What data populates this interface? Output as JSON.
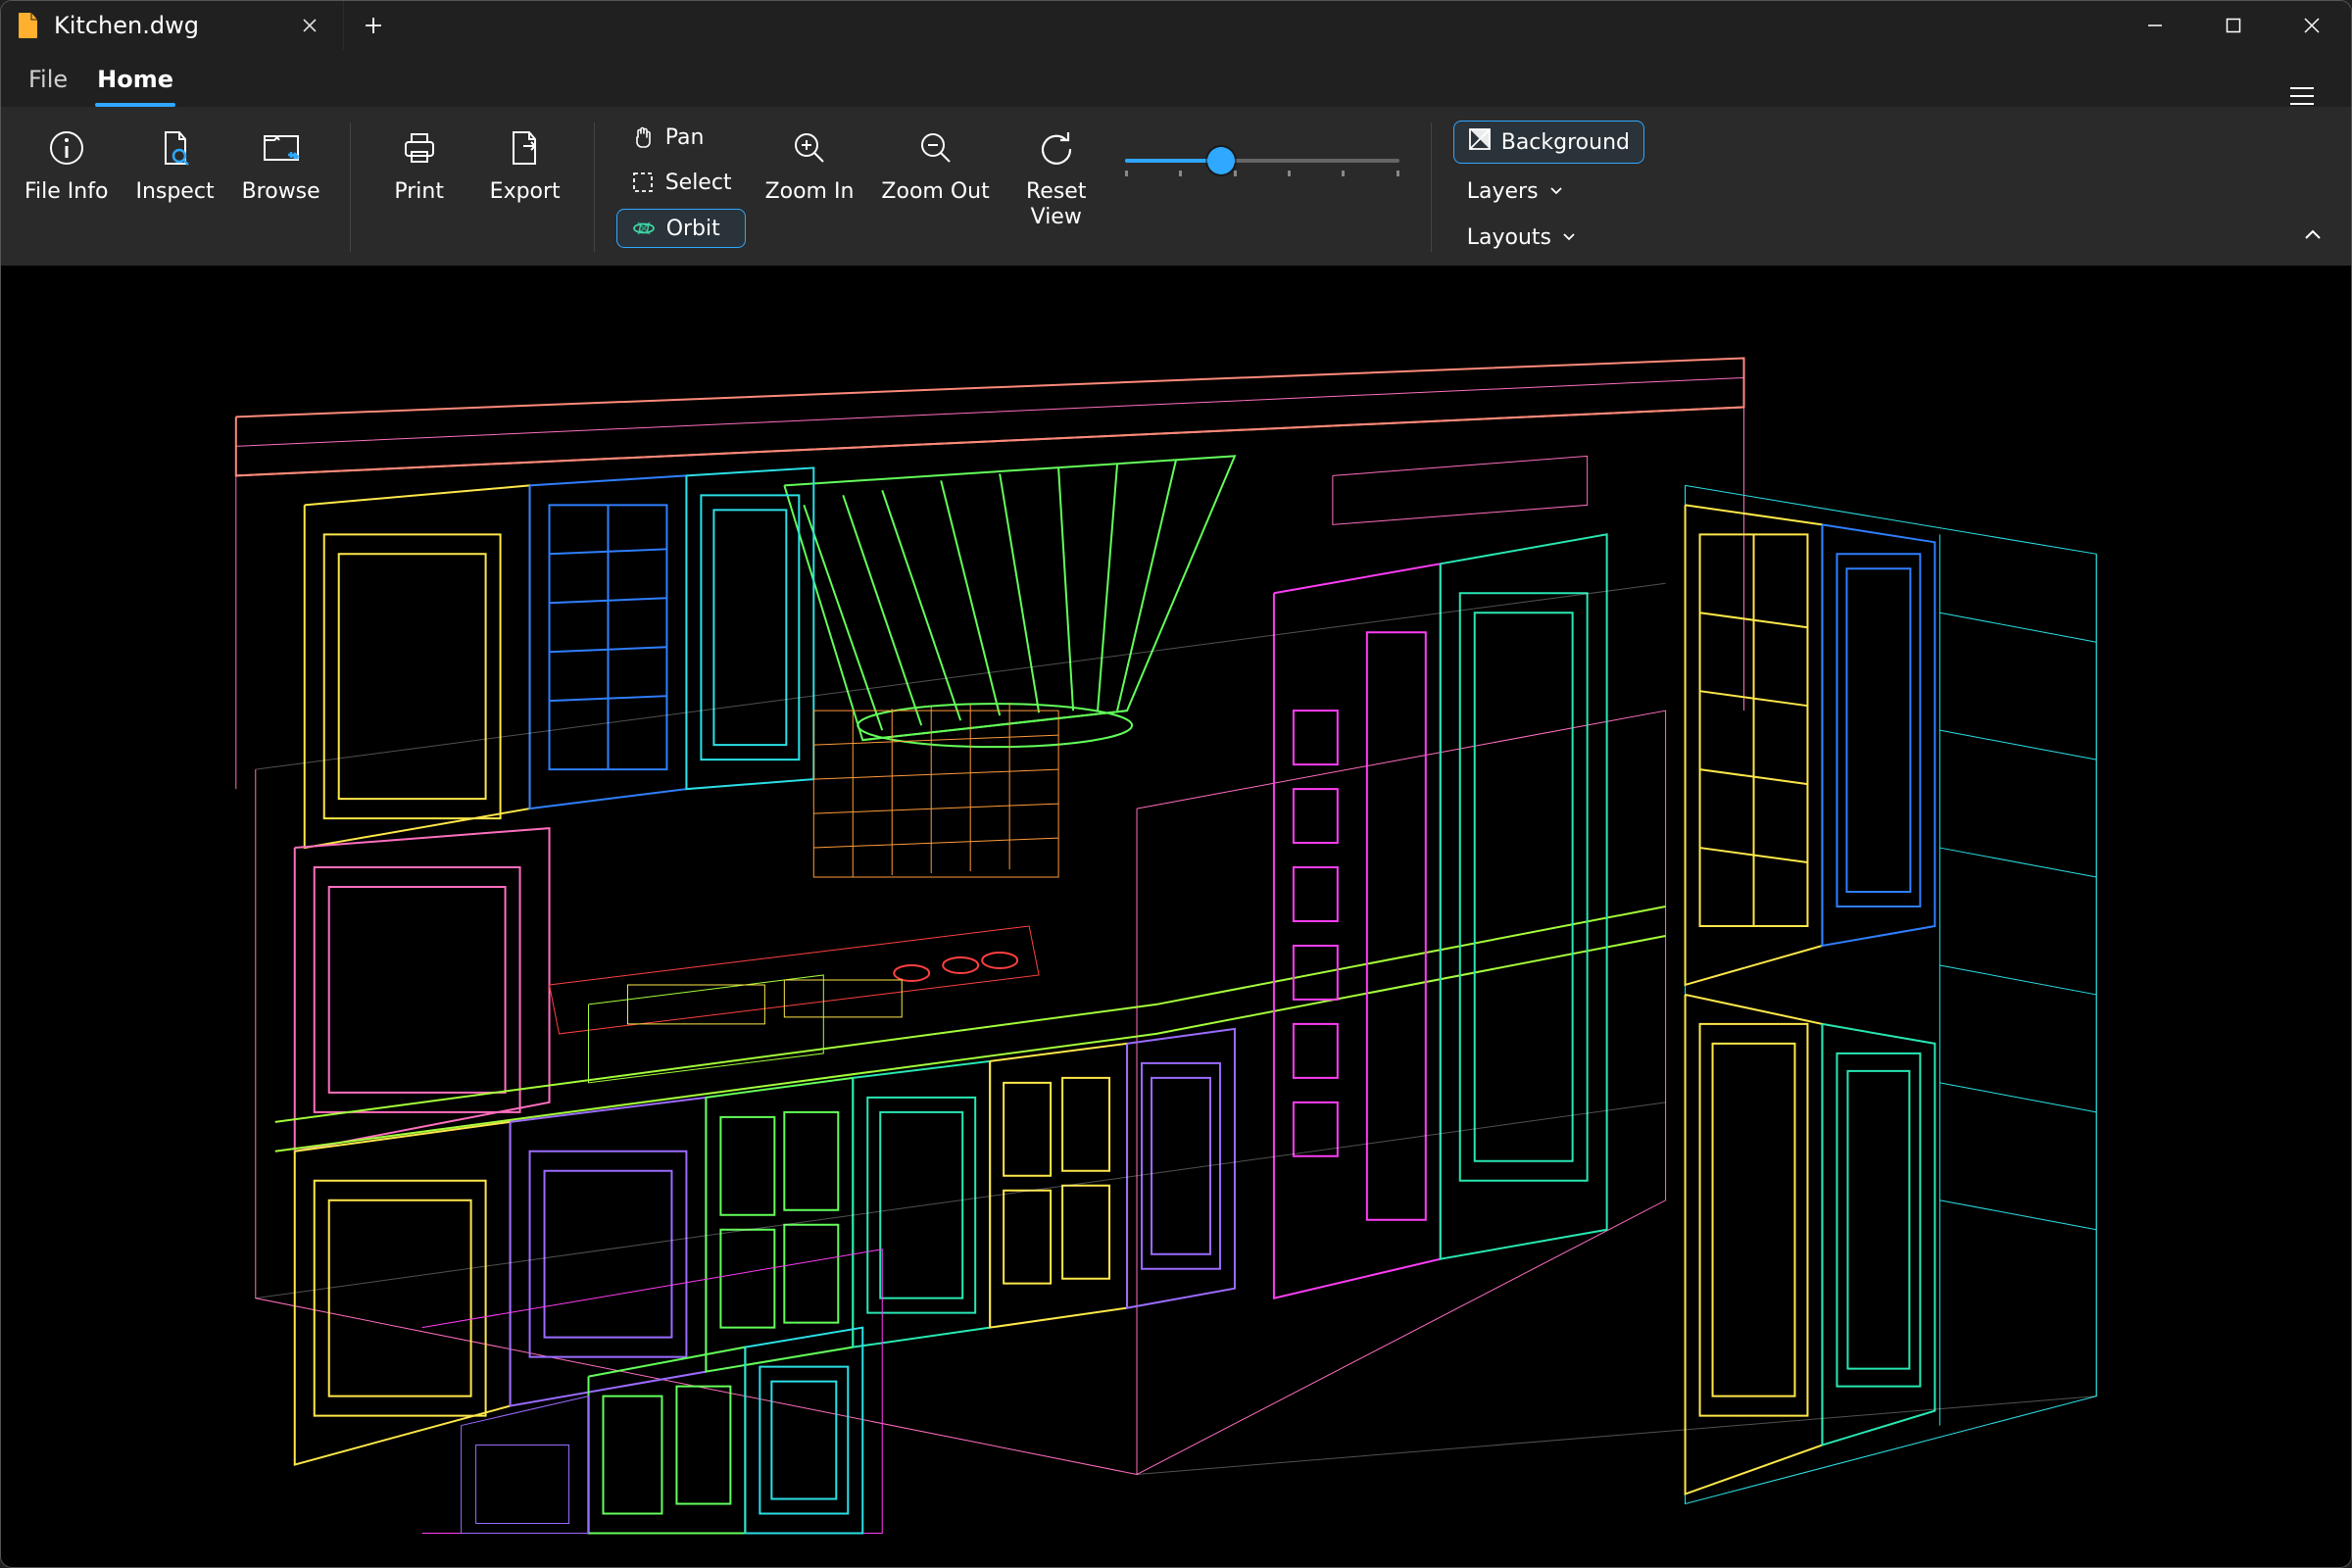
{
  "tab": {
    "title": "Kitchen.dwg"
  },
  "menu": {
    "file": "File",
    "home": "Home"
  },
  "ribbon": {
    "fileinfo": "File Info",
    "inspect": "Inspect",
    "browse": "Browse",
    "print": "Print",
    "export": "Export",
    "pan": "Pan",
    "select": "Select",
    "orbit": "Orbit",
    "zoomin": "Zoom In",
    "zoomout": "Zoom Out",
    "resetview": "Reset\nView",
    "background": "Background",
    "layers": "Layers",
    "layouts": "Layouts",
    "zoom_slider_percent": 35
  },
  "colors": {
    "accent": "#2fa8ff",
    "orbit_green": "#3cd6a5",
    "viewport_bg": "#000000"
  },
  "wireframe_palette": {
    "magenta": "#ff3df6",
    "pink": "#ff6fbf",
    "cyan": "#2be0e6",
    "teal": "#28e7b3",
    "yellow": "#ffe84a",
    "green": "#63ff5a",
    "lime": "#a4ff3a",
    "blue": "#2f7fff",
    "violet": "#9a6cff",
    "orange": "#ff9a3a",
    "salmon": "#ff8a7a",
    "red": "#ff4040",
    "white": "#e8e8e8"
  }
}
